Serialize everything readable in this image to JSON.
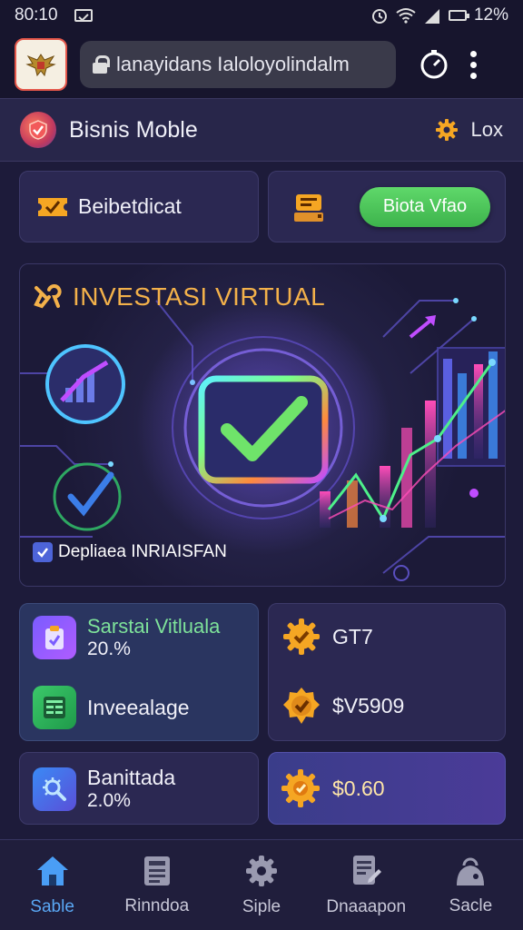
{
  "status_bar": {
    "time": "80:10",
    "battery": "12%"
  },
  "browser": {
    "url": "lanayidans Ialoloyolindalm"
  },
  "app": {
    "title": "Bisnis Moble",
    "header_right_label": "Lox"
  },
  "top_cards": {
    "left_label": "Beibetdicat",
    "right_button": "Biota Vfao"
  },
  "hero": {
    "title": "INVESTASI VIRTUAL",
    "footer_label": "Depliaea INRIAISFAN"
  },
  "stats": {
    "card1": {
      "title": "Sarstai Vitluala",
      "value": "20.%"
    },
    "card2": {
      "label": "Inveealage"
    },
    "card3": {
      "value": "GT7"
    },
    "card4": {
      "value": "$V5909"
    },
    "card5": {
      "title": "Banittada",
      "value": "2.0%"
    },
    "card6": {
      "value": "$0.60"
    }
  },
  "nav": {
    "items": [
      {
        "label": "Sable",
        "icon": "home-icon"
      },
      {
        "label": "Rinndoa",
        "icon": "news-icon"
      },
      {
        "label": "Siple",
        "icon": "gear-icon"
      },
      {
        "label": "Dnaaapon",
        "icon": "document-icon"
      },
      {
        "label": "Sacle",
        "icon": "bag-icon"
      }
    ]
  },
  "colors": {
    "background": "#1d1b3a",
    "accent_green": "#4cc75a",
    "accent_gold": "#f3b14a",
    "nav_active": "#5aa8f5"
  }
}
